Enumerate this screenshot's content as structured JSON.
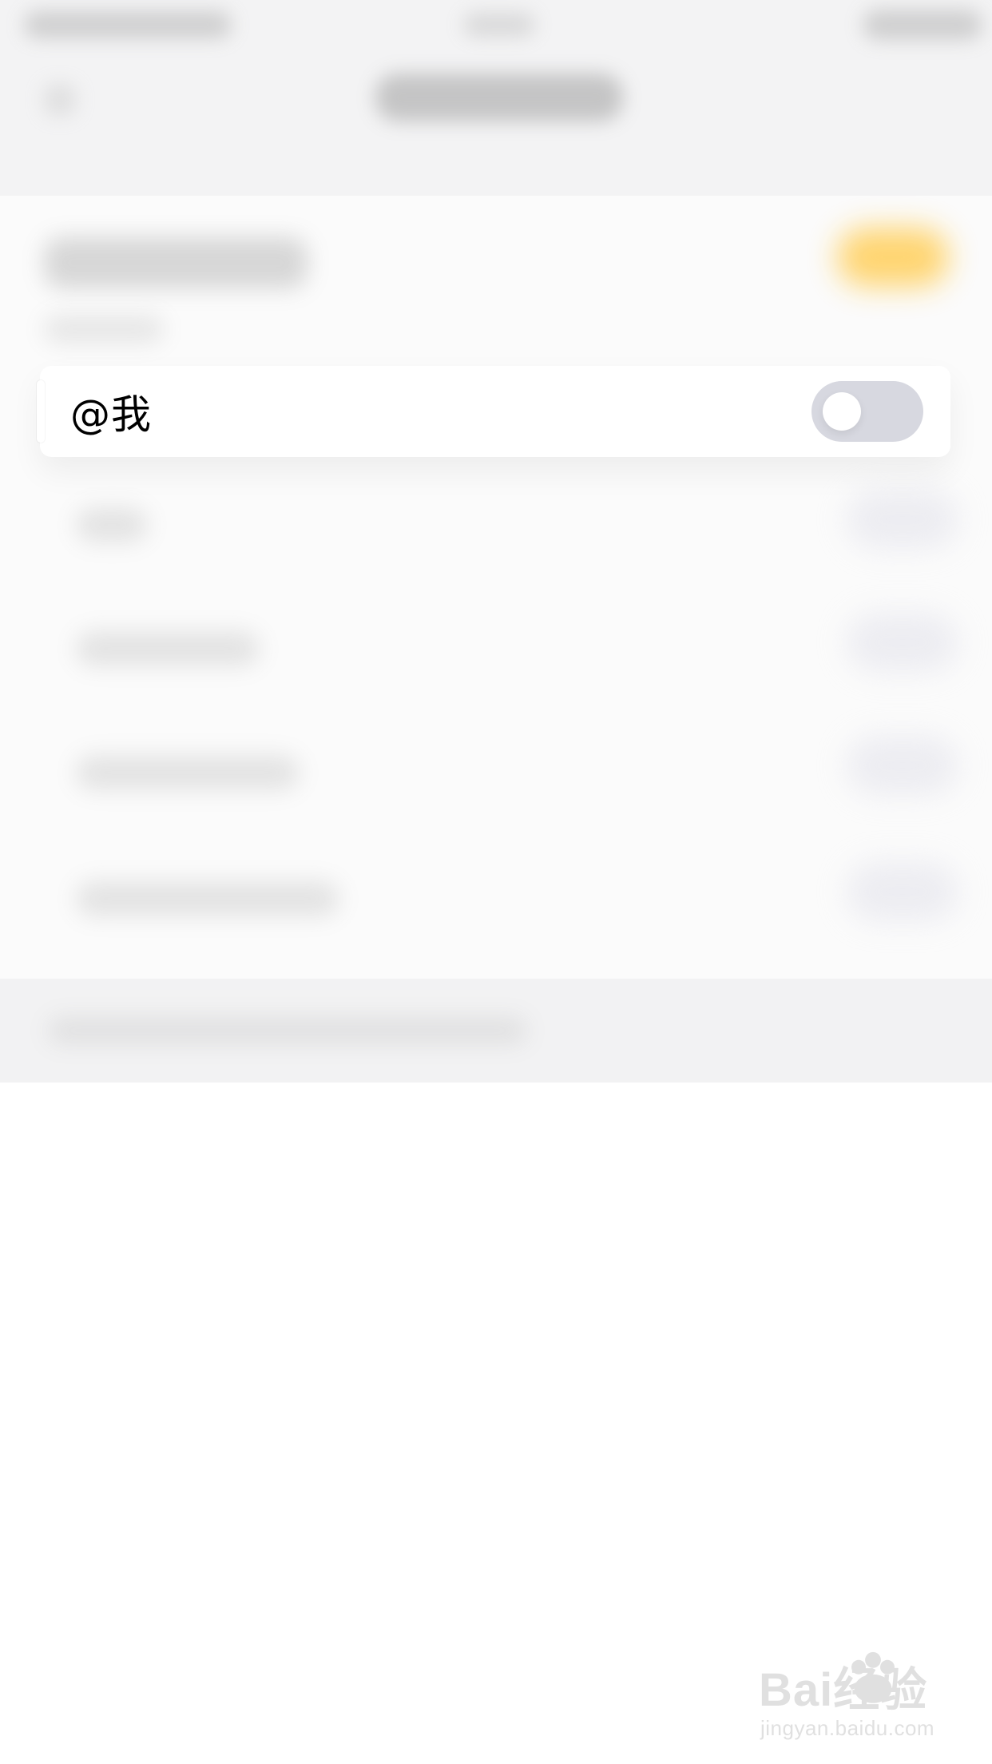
{
  "settings": {
    "focused_row": {
      "label": "@我",
      "toggle_on": false
    }
  },
  "watermark": {
    "main_text": "Bai经验",
    "sub_text": "jingyan.baidu.com"
  },
  "colors": {
    "toggle_off": "#d7d8e0",
    "accent_on": "#ffd36a"
  }
}
